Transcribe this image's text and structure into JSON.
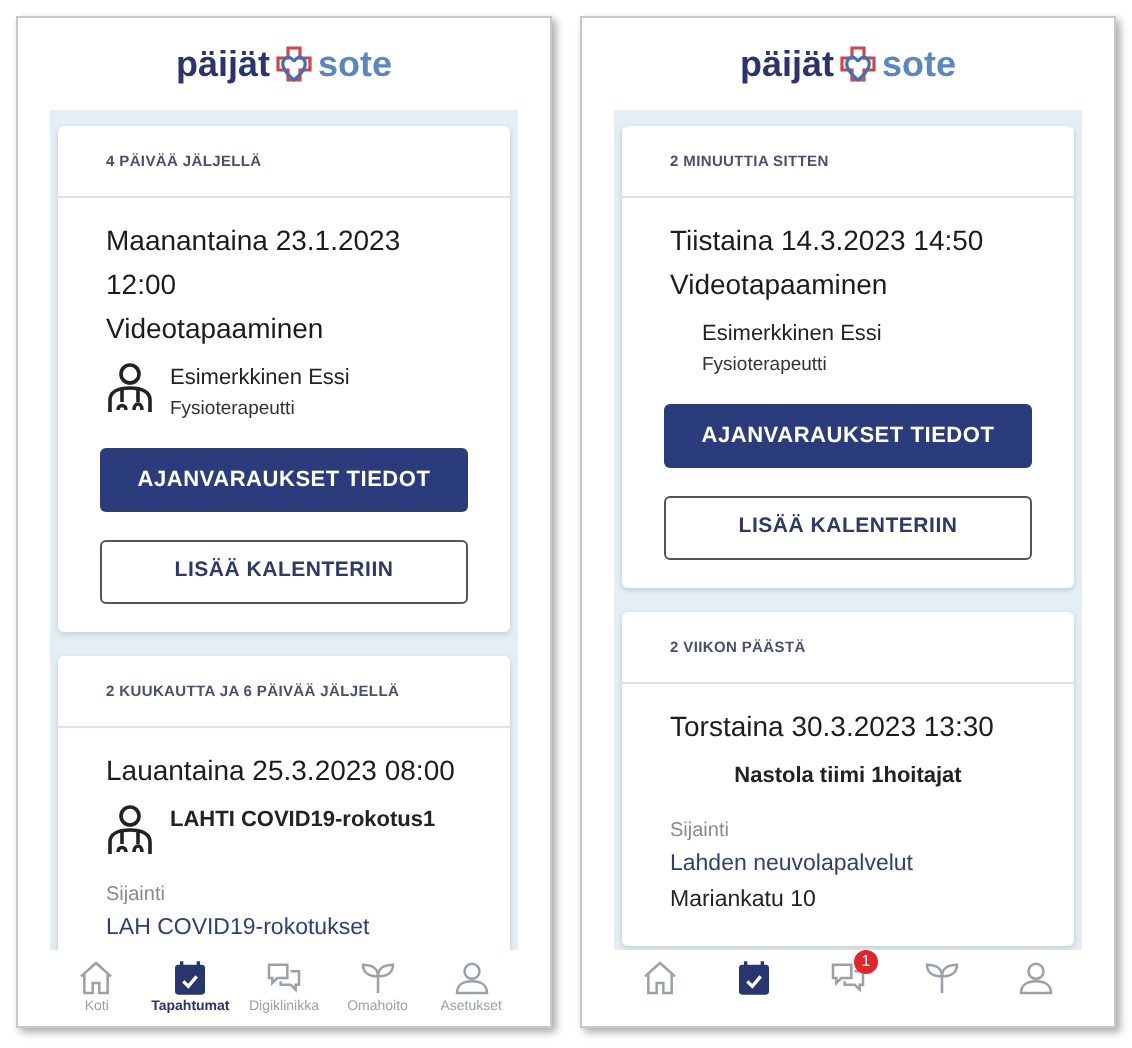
{
  "phones": [
    {
      "logo": {
        "left": "päijät",
        "right": "sote"
      },
      "cards": [
        {
          "header": "4 PÄIVÄÄ JÄLJELLÄ",
          "blocks": [
            {
              "kind": "heading",
              "lines": [
                "Maanantaina 23.1.2023",
                "12:00",
                "Videotapaaminen"
              ]
            },
            {
              "kind": "person",
              "icon": true,
              "name": "Esimerkkinen Essi",
              "role": "Fysioterapeutti"
            },
            {
              "kind": "buttons",
              "buttons": [
                {
                  "label": "AJANVARAUKSET TIEDOT",
                  "kind": "primary"
                },
                {
                  "label": "LISÄÄ KALENTERIIN",
                  "kind": "outline"
                }
              ]
            }
          ]
        },
        {
          "header": "2 KUUKAUTTA JA 6 PÄIVÄÄ JÄLJELLÄ",
          "blocks": [
            {
              "kind": "heading",
              "lines": [
                "Lauantaina 25.3.2023 08:00"
              ]
            },
            {
              "kind": "person",
              "icon": true,
              "name": "LAHTI COVID19-rokotus1"
            },
            {
              "kind": "location",
              "label": "Sijainti",
              "lines": [
                "LAH COVID19-rokotukset"
              ]
            }
          ]
        }
      ],
      "nav": [
        {
          "label": "Koti",
          "selected": false
        },
        {
          "label": "Tapahtumat",
          "selected": true
        },
        {
          "label": "Digiklinikka",
          "selected": false
        },
        {
          "label": "Omahoito",
          "selected": false
        },
        {
          "label": "Asetukset",
          "selected": false
        }
      ]
    },
    {
      "logo": {
        "left": "päijät",
        "right": "sote"
      },
      "cards": [
        {
          "header": "2 MINUUTTIA SITTEN",
          "blocks": [
            {
              "kind": "heading",
              "lines": [
                "Tiistaina 14.3.2023 14:50",
                "Videotapaaminen"
              ]
            },
            {
              "kind": "person",
              "icon": false,
              "name": "Esimerkkinen Essi",
              "role": "Fysioterapeutti"
            },
            {
              "kind": "buttons",
              "buttons": [
                {
                  "label": "AJANVARAUKSET TIEDOT",
                  "kind": "primary"
                },
                {
                  "label": "LISÄÄ KALENTERIIN",
                  "kind": "outline"
                }
              ]
            }
          ]
        },
        {
          "header": "2 VIIKON PÄÄSTÄ",
          "blocks": [
            {
              "kind": "heading",
              "lines": [
                "Torstaina 30.3.2023 13:30"
              ]
            },
            {
              "kind": "team",
              "name": "Nastola tiimi 1hoitajat"
            },
            {
              "kind": "location",
              "label": "Sijainti",
              "lines": [
                "Lahden neuvolapalvelut",
                "Mariankatu 10"
              ]
            }
          ]
        }
      ],
      "nav": [
        {
          "selected": false
        },
        {
          "selected": true
        },
        {
          "selected": false,
          "badge": "1"
        },
        {
          "selected": false
        },
        {
          "selected": false
        }
      ]
    }
  ]
}
